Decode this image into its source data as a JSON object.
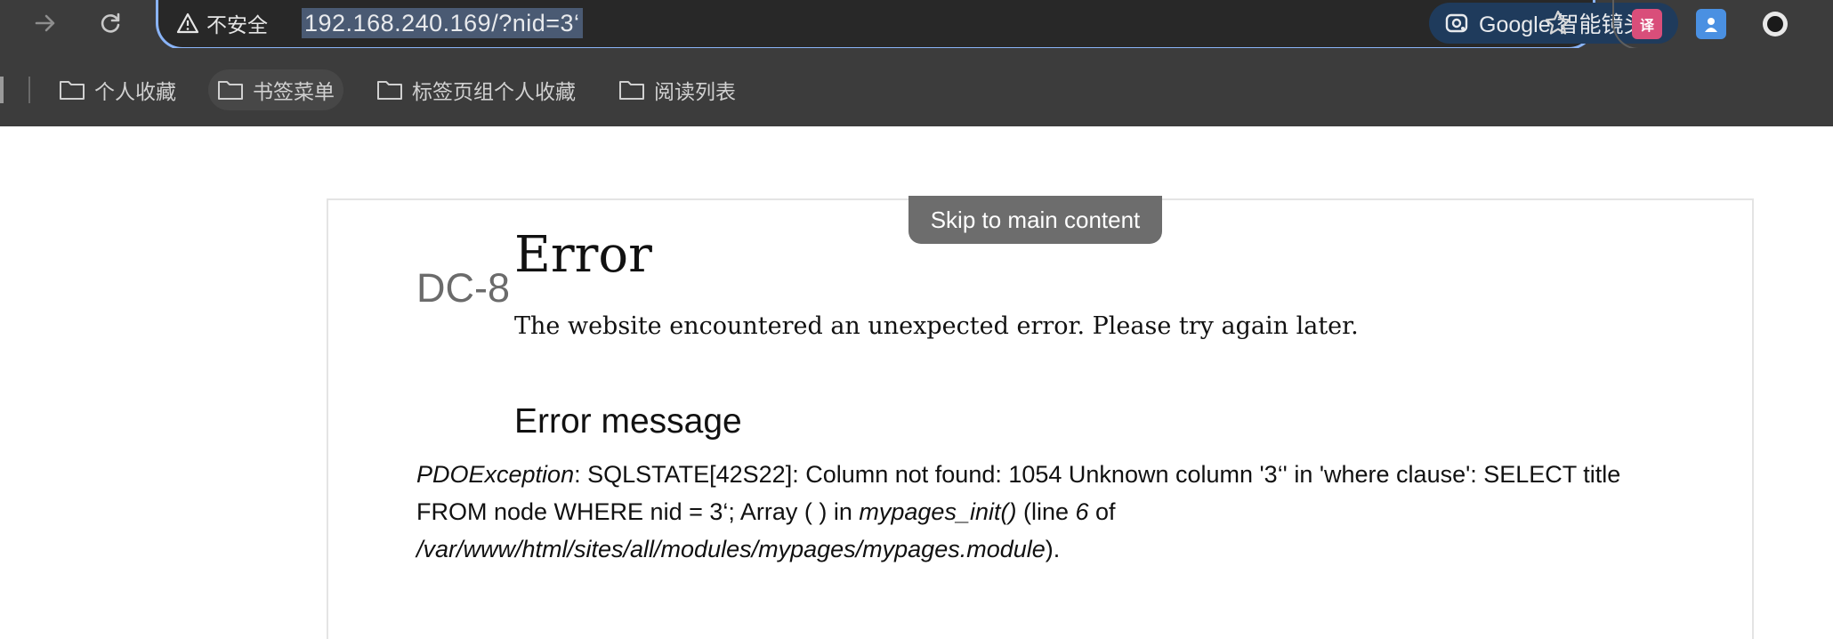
{
  "browser": {
    "security_label": "不安全",
    "url": "192.168.240.169/?nid=3‘",
    "lens_label": "Google 智能镜头",
    "bookmarks": [
      {
        "label": "个人收藏"
      },
      {
        "label": "书签菜单"
      },
      {
        "label": "标签页组个人收藏"
      },
      {
        "label": "阅读列表"
      }
    ],
    "icons": {
      "back": "back-arrow-icon",
      "forward": "forward-arrow-icon",
      "reload": "reload-icon",
      "warning": "warning-triangle-icon",
      "lens": "google-lens-icon",
      "star": "bookmark-star-icon",
      "extensions": [
        "translate-extension-icon",
        "assistant-extension-icon",
        "circle-extension-icon"
      ]
    },
    "colors": {
      "chrome_bg": "#3c3c3c",
      "omnibox_border": "#8ab4f8",
      "url_highlight": "#4a5a73"
    }
  },
  "page": {
    "skip_link": "Skip to main content",
    "site_name": "DC-8",
    "title": "Error",
    "subtitle": "The website encountered an unexpected error. Please try again later.",
    "section_heading": "Error message",
    "error": {
      "exception": "PDOException",
      "message": ": SQLSTATE[42S22]: Column not found: 1054 Unknown column '3‘' in 'where clause': SELECT title FROM node WHERE nid = 3‘; Array ( ) in ",
      "function": "mypages_init()",
      "line_prefix": " (line ",
      "line": "6",
      "of": " of ",
      "file": "/var/www/html/sites/all/modules/mypages/mypages.module",
      "suffix": ")."
    }
  }
}
